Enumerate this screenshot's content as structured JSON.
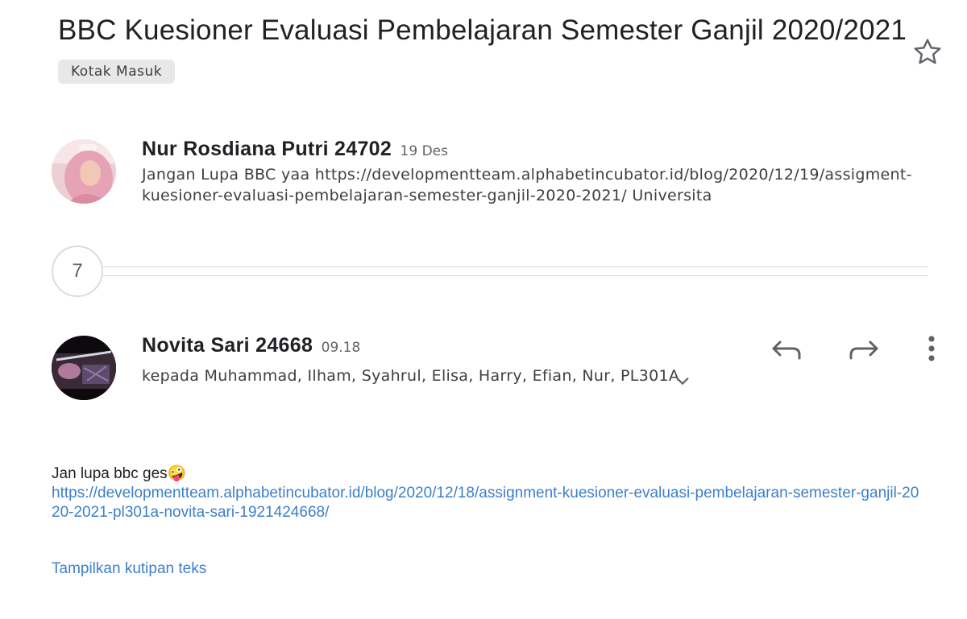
{
  "thread": {
    "subject": "BBC Kuesioner Evaluasi Pembelajaran Semester Ganjil 2020/2021",
    "label": "Kotak Masuk",
    "collapsed_count": "7"
  },
  "messages": [
    {
      "sender": "Nur Rosdiana Putri 24702",
      "time": "19 Des",
      "snippet": "Jangan Lupa BBC yaa https://developmentteam.alphabetincubator.id/blog/2020/12/19/assigment-kuesioner-evaluasi-pembelajaran-semester-ganjil-2020-2021/ Universita"
    },
    {
      "sender": "Novita Sari 24668",
      "time": "09.18",
      "recipients": "kepada Muhammad, Ilham, Syahrul, Elisa, Harry, Efian, Nur, PL301A",
      "body_text": "Jan lupa bbc ges🤪",
      "body_link": "https://developmentteam.alphabetincubator.id/blog/2020/12/18/assignment-kuesioner-evaluasi-pembelajaran-semester-ganjil-2020-2021-pl301a-novita-sari-1921424668/",
      "show_quoted": "Tampilkan kutipan teks"
    }
  ],
  "icons": {
    "star": "star-outline-icon",
    "reply": "reply-icon",
    "forward": "forward-icon",
    "more": "more-vert-icon",
    "expand": "chevron-down-icon"
  },
  "colors": {
    "link": "#3d7fc9",
    "chip_bg": "#e8e8e8",
    "text_primary": "#202124",
    "text_secondary": "#5f6368"
  }
}
